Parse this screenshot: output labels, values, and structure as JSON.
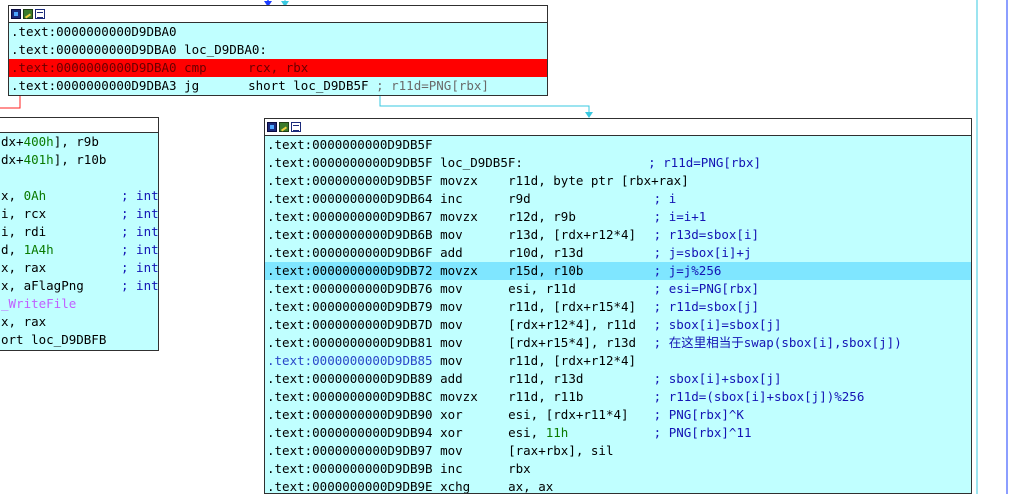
{
  "colors": {
    "background": "#ffffff",
    "block_fill": "#c0ffff",
    "highlight_row": "#7fe6ff",
    "breakpoint_row": "#ff0000",
    "comment": "#1414b4",
    "number": "#0a7a00",
    "address_blue": "#2a47c8",
    "edge_blue": "#1a3cff",
    "edge_cyan": "#39c8e0",
    "edge_red": "#ff2020"
  },
  "icons": [
    "graph-icon",
    "edit-icon",
    "list-icon"
  ],
  "block_top": {
    "lines": [
      {
        "addr": ".text:0000000000D9DBA0",
        "mnem": "",
        "ops": "",
        "comment": ""
      },
      {
        "addr": ".text:0000000000D9DBA0",
        "mnem": "loc_D9DBA0:",
        "ops": "",
        "comment": ""
      },
      {
        "addr": ".text:0000000000D9DBA0",
        "mnem": "cmp",
        "ops": "rcx, rbx",
        "comment": ""
      },
      {
        "addr": ".text:0000000000D9DBA3",
        "mnem": "jg",
        "ops": "short loc_D9DB5F",
        "comment": "; r11d=PNG[rbx]"
      }
    ]
  },
  "block_left": {
    "lines": [
      {
        "text": "dx+",
        "num": "400h",
        "tail": "], r9b",
        "comment": ""
      },
      {
        "text": "dx+",
        "num": "401h",
        "tail": "], r10b",
        "comment": ""
      },
      {
        "text": "",
        "num": "",
        "tail": "",
        "comment": ""
      },
      {
        "text": "x, ",
        "num": "0Ah",
        "tail": "",
        "comment": "; int"
      },
      {
        "text": "i, rcx",
        "num": "",
        "tail": "",
        "comment": "; int"
      },
      {
        "text": "i, rdi",
        "num": "",
        "tail": "",
        "comment": "; int"
      },
      {
        "text": "d, ",
        "num": "1A4h",
        "tail": "",
        "comment": "; int"
      },
      {
        "text": "x, rax",
        "num": "",
        "tail": "",
        "comment": "; int"
      },
      {
        "text": "x, aFlagPng",
        "num": "",
        "tail": "",
        "comment": "; int"
      },
      {
        "text": "_WriteFile",
        "num": "",
        "tail": "",
        "comment": ""
      },
      {
        "text": "x, rax",
        "num": "",
        "tail": "",
        "comment": ""
      },
      {
        "text": "ort loc_D9DBFB",
        "num": "",
        "tail": "",
        "comment": ""
      }
    ]
  },
  "block_main": {
    "lines": [
      {
        "addr": ".text:0000000000D9DB5F",
        "mnem": "",
        "ops": "",
        "comment": ""
      },
      {
        "addr": ".text:0000000000D9DB5F",
        "mnem": "loc_D9DB5F:",
        "ops": "",
        "comment": "; r11d=PNG[rbx]"
      },
      {
        "addr": ".text:0000000000D9DB5F",
        "mnem": "movzx",
        "ops": "r11d, byte ptr [rbx+rax]",
        "comment": ""
      },
      {
        "addr": ".text:0000000000D9DB64",
        "mnem": "inc",
        "ops": "r9d",
        "comment": "; i"
      },
      {
        "addr": ".text:0000000000D9DB67",
        "mnem": "movzx",
        "ops": "r12d, r9b",
        "comment": "; i=i+1"
      },
      {
        "addr": ".text:0000000000D9DB6B",
        "mnem": "mov",
        "ops": "r13d, [rdx+r12*4]",
        "comment": "; r13d=sbox[i]"
      },
      {
        "addr": ".text:0000000000D9DB6F",
        "mnem": "add",
        "ops": "r10d, r13d",
        "comment": "; j=sbox[i]+j"
      },
      {
        "addr": ".text:0000000000D9DB72",
        "mnem": "movzx",
        "ops": "r15d, r10b",
        "comment": "; j=j%256"
      },
      {
        "addr": ".text:0000000000D9DB76",
        "mnem": "mov",
        "ops": "esi, r11d",
        "comment": "; esi=PNG[rbx]"
      },
      {
        "addr": ".text:0000000000D9DB79",
        "mnem": "mov",
        "ops": "r11d, [rdx+r15*4]",
        "comment": "; r11d=sbox[j]"
      },
      {
        "addr": ".text:0000000000D9DB7D",
        "mnem": "mov",
        "ops": "[rdx+r12*4], r11d",
        "comment": "; sbox[i]=sbox[j]"
      },
      {
        "addr": ".text:0000000000D9DB81",
        "mnem": "mov",
        "ops": "[rdx+r15*4], r13d",
        "comment": "; 在这里相当于swap(sbox[i],sbox[j])"
      },
      {
        "addr": ".text:0000000000D9DB85",
        "mnem": "mov",
        "ops": "r11d, [rdx+r12*4]",
        "comment": ""
      },
      {
        "addr": ".text:0000000000D9DB89",
        "mnem": "add",
        "ops": "r11d, r13d",
        "comment": "; sbox[i]+sbox[j]"
      },
      {
        "addr": ".text:0000000000D9DB8C",
        "mnem": "movzx",
        "ops": "r11d, r11b",
        "comment": "; r11d=(sbox[i]+sbox[j])%256"
      },
      {
        "addr": ".text:0000000000D9DB90",
        "mnem": "xor",
        "ops": "esi, [rdx+r11*4]",
        "comment": "; PNG[rbx]^K"
      },
      {
        "addr": ".text:0000000000D9DB94",
        "mnem": "xor",
        "ops": "esi, 11h",
        "comment": "; PNG[rbx]^11"
      },
      {
        "addr": ".text:0000000000D9DB97",
        "mnem": "mov",
        "ops": "[rax+rbx], sil",
        "comment": ""
      },
      {
        "addr": ".text:0000000000D9DB9B",
        "mnem": "inc",
        "ops": "rbx",
        "comment": ""
      },
      {
        "addr": ".text:0000000000D9DB9E",
        "mnem": "xchg",
        "ops": "ax, ax",
        "comment": ""
      }
    ]
  }
}
